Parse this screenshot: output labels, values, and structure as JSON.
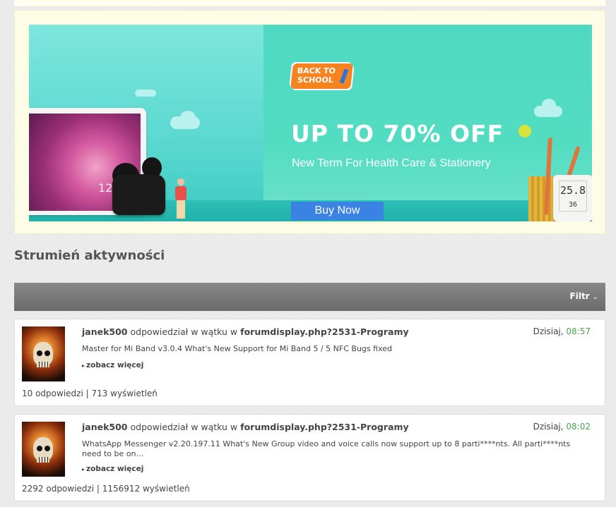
{
  "banner": {
    "badge": "BACK TO SCHOOL",
    "title": "UP TO 70% OFF",
    "subtitle": "New Term For Health Care & Stationery",
    "button": "Buy Now",
    "tablet_text": "12",
    "thermo_reading": "25.8",
    "thermo_humidity": "36"
  },
  "stream": {
    "title": "Strumień aktywności",
    "filter_label": "Filtr"
  },
  "posts": [
    {
      "user": "janek500",
      "action": "odpowiedział w wątku w",
      "thread": "forumdisplay.php?2531-Programy",
      "date": "Dzisiaj,",
      "time": "08:57",
      "excerpt": "Master for Mi Band v3.0.4 What's New Support for Mi Band 5 / 5 NFC Bugs fixed",
      "more": "zobacz więcej",
      "stats": "10 odpowiedzi | 713 wyświetleń"
    },
    {
      "user": "janek500",
      "action": "odpowiedział w wątku w",
      "thread": "forumdisplay.php?2531-Programy",
      "date": "Dzisiaj,",
      "time": "08:02",
      "excerpt": "WhatsApp Messenger v2.20.197.11 What's New Group video and voice calls now support up to 8 parti****nts. All parti****nts need to be on...",
      "more": "zobacz więcej",
      "stats": "2292 odpowiedzi | 1156912 wyświetleń"
    }
  ]
}
